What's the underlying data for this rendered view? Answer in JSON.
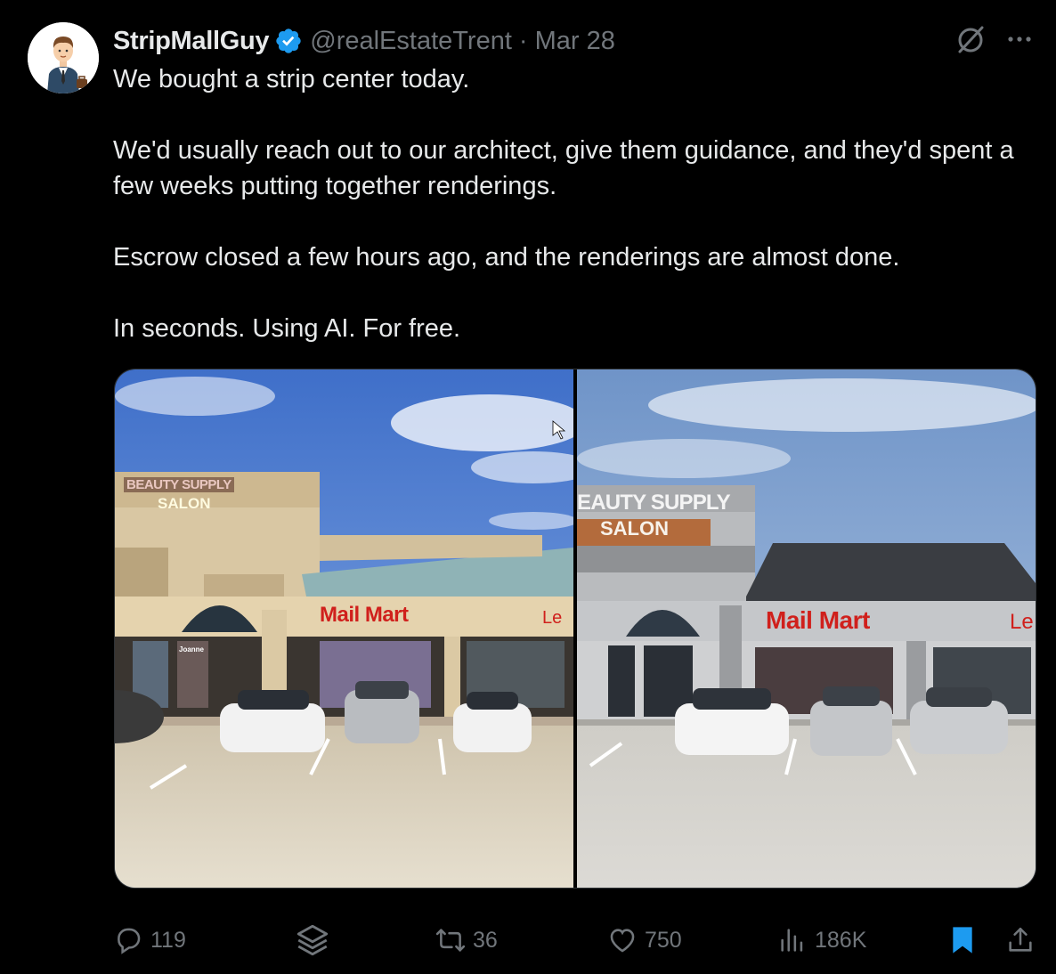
{
  "author": {
    "name": "StripMallGuy",
    "handle": "@realEstateTrent",
    "separator": "·",
    "date": "Mar 28",
    "verified": true
  },
  "icons": {
    "verified": "verified-badge-icon",
    "grok": "grok-icon",
    "more": "more-icon",
    "reply": "reply-icon",
    "bookmark_folder": "layers-icon",
    "retweet": "retweet-icon",
    "like": "heart-icon",
    "views": "views-icon",
    "bookmark": "bookmark-icon",
    "share": "share-icon"
  },
  "tweet": {
    "paragraphs": [
      "We bought a strip center today.",
      "We'd usually reach out to our architect, give them guidance, and they'd spent a few weeks putting together renderings.",
      "Escrow closed a few hours ago, and the renderings are almost done.",
      "In seconds.  Using AI.  For free."
    ]
  },
  "media": {
    "left": {
      "sign_top": "BEAUTY SUPPLY",
      "sign_bottom": "SALON",
      "store": "Mail Mart",
      "store_next": "Le",
      "window_text": "Joanne"
    },
    "right": {
      "sign_top": "EAUTY SUPPLY",
      "sign_bottom": "SALON",
      "store": "Mail Mart",
      "store_next": "Le"
    }
  },
  "actions": {
    "replies": "119",
    "retweets": "36",
    "likes": "750",
    "views": "186K"
  },
  "colors": {
    "background": "#000000",
    "text": "#e7e9ea",
    "secondary": "#71767b",
    "verified": "#1d9bf0",
    "bookmark_active": "#1d9bf0",
    "sign_red": "#d0201c"
  }
}
